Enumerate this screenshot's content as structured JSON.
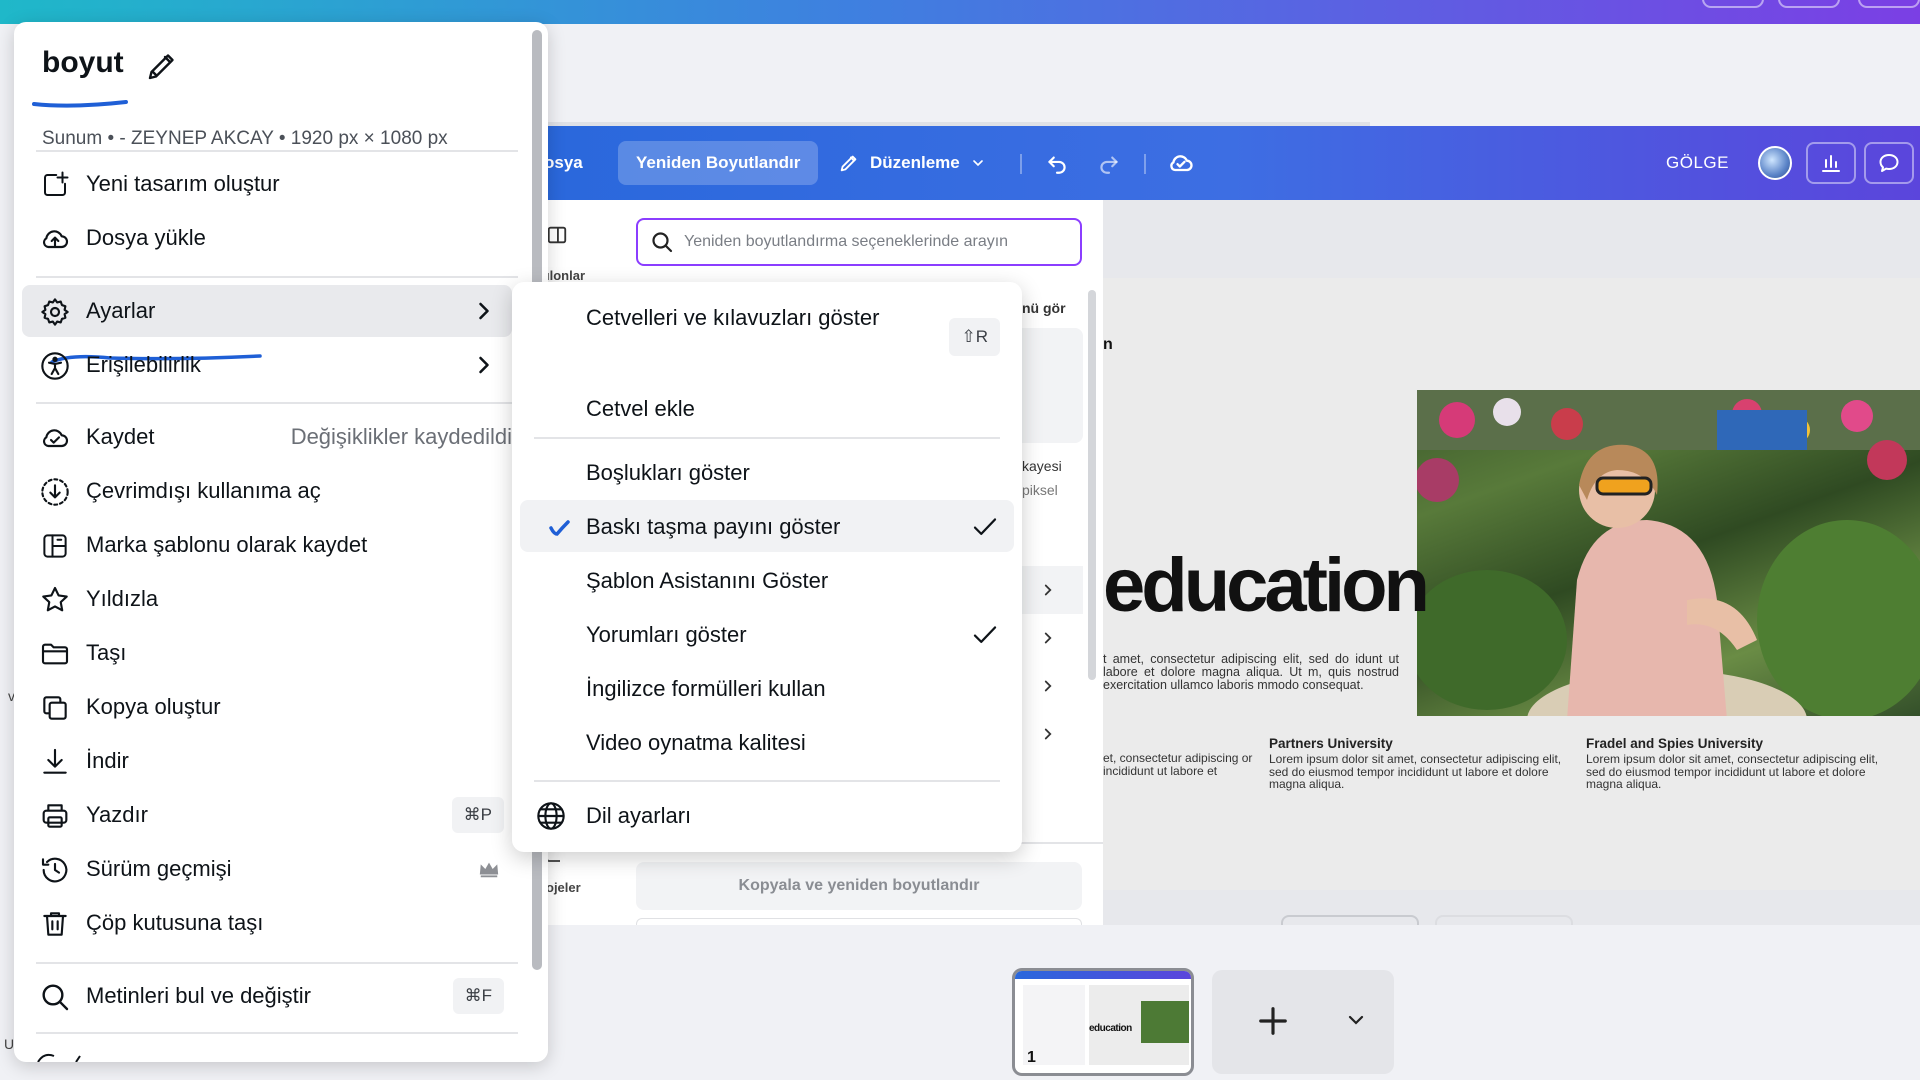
{
  "colors": {
    "accent": "#8b3dff",
    "header_start": "#2a68dc",
    "header_end": "#5b45dc",
    "annotation_blue": "#1f5fd6"
  },
  "menu": {
    "title": "boyut",
    "subtitle": "Sunum • - ZEYNEP AKCAY • 1920 px × 1080 px",
    "items": [
      {
        "label": "Yeni tasarım oluştur",
        "icon": "new-design-icon"
      },
      {
        "label": "Dosya yükle",
        "icon": "cloud-upload-icon"
      },
      {
        "label": "Ayarlar",
        "icon": "gear-icon"
      },
      {
        "label": "Erişilebilirlik",
        "icon": "accessibility-icon"
      },
      {
        "label": "Kaydet",
        "icon": "cloud-check-icon",
        "status": "Değişiklikler kaydedildi"
      },
      {
        "label": "Çevrimdışı kullanıma aç",
        "icon": "offline-download-icon"
      },
      {
        "label": "Marka şablonu olarak kaydet",
        "icon": "brand-template-icon"
      },
      {
        "label": "Yıldızla",
        "icon": "star-icon"
      },
      {
        "label": "Taşı",
        "icon": "folder-icon"
      },
      {
        "label": "Kopya oluştur",
        "icon": "copy-icon"
      },
      {
        "label": "İndir",
        "icon": "download-icon"
      },
      {
        "label": "Yazdır",
        "icon": "printer-icon",
        "shortcut": "⌘P"
      },
      {
        "label": "Sürüm geçmişi",
        "icon": "history-icon"
      },
      {
        "label": "Çöp kutusuna taşı",
        "icon": "trash-icon"
      },
      {
        "label": "Metinleri bul ve değiştir",
        "icon": "search-icon",
        "shortcut": "⌘F"
      }
    ]
  },
  "submenu": {
    "items": [
      {
        "label": "Cetvelleri ve kılavuzları göster",
        "shortcut": "⇧R"
      },
      {
        "label": "Cetvel ekle"
      },
      {
        "label": "Boşlukları göster"
      },
      {
        "label": "Baskı taşma payını göster",
        "checked": true
      },
      {
        "label": "Şablon Asistanını Göster"
      },
      {
        "label": "Yorumları göster",
        "checked": true
      },
      {
        "label": "İngilizce formülleri kullan"
      },
      {
        "label": "Video oynatma kalitesi"
      },
      {
        "label": "Dil ayarları",
        "icon": "globe-icon"
      }
    ]
  },
  "editor": {
    "header": {
      "file": "osya",
      "resize": "Yeniden Boyutlandır",
      "edit": "Düzenleme",
      "shadow": "GÖLGE"
    },
    "rail": {
      "top_label": "ılonlar",
      "bottom_label": "ojeler"
    },
    "resize_panel": {
      "search_placeholder": "Yeniden boyutlandırma seçeneklerinde arayın",
      "frag_menu": "nü gör",
      "frag_kayesi": "kayesi",
      "frag_piksel": "piksel",
      "copy_button": "Kopyala ve yeniden boyutlandır"
    },
    "slide": {
      "letter": "n",
      "headline": "education",
      "lorem": "t amet, consectetur adipiscing elit, sed do idunt ut labore et dolore magna aliqua. Ut m, quis nostrud exercitation ullamco laboris mmodo consequat.",
      "col0": "et, consectetur adipiscing or incididunt ut labore et",
      "col1_title": "Partners University",
      "col1_body": "Lorem ipsum dolor sit amet, consectetur adipiscing elit, sed do eiusmod tempor incididunt ut labore et dolore magna aliqua.",
      "col2_title": "Fradel and Spies University",
      "col2_body": "Lorem ipsum dolor sit amet, consectetur adipiscing elit, sed do eiusmod tempor incididunt ut labore et dolore magna aliqua."
    },
    "thumbnail": {
      "page_number": "1",
      "mini_headline": "education"
    }
  },
  "edge_fragments": {
    "left_top": "v",
    "left_bottom": "U"
  }
}
